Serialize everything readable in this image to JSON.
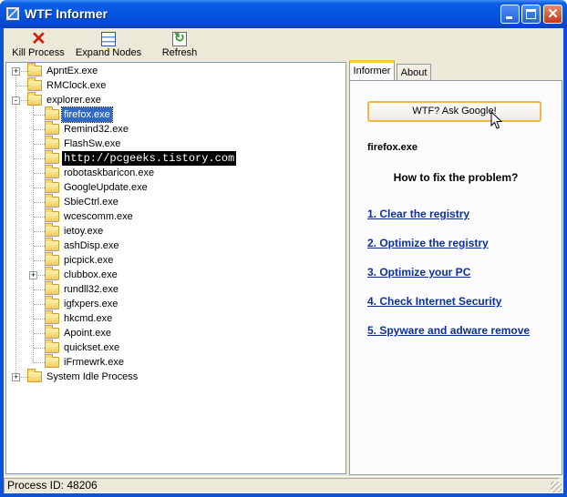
{
  "window": {
    "title": "WTF Informer"
  },
  "toolbar": {
    "kill_label": "Kill Process",
    "expand_label": "Expand Nodes",
    "refresh_label": "Refresh"
  },
  "tree": {
    "nodes": [
      {
        "label": "ApntEx.exe",
        "level": 0,
        "expander": "+"
      },
      {
        "label": "RMClock.exe",
        "level": 0,
        "expander": ""
      },
      {
        "label": "explorer.exe",
        "level": 0,
        "expander": "-"
      },
      {
        "label": "firefox.exe",
        "level": 1,
        "expander": "",
        "selected": true
      },
      {
        "label": "Remind32.exe",
        "level": 1,
        "expander": ""
      },
      {
        "label": "FlashSw.exe",
        "level": 1,
        "expander": ""
      },
      {
        "label": "http://pcgeeks.tistory.com",
        "level": 1,
        "expander": "",
        "dark": true
      },
      {
        "label": "robotaskbaricon.exe",
        "level": 1,
        "expander": ""
      },
      {
        "label": "GoogleUpdate.exe",
        "level": 1,
        "expander": ""
      },
      {
        "label": "SbieCtrl.exe",
        "level": 1,
        "expander": ""
      },
      {
        "label": "wcescomm.exe",
        "level": 1,
        "expander": ""
      },
      {
        "label": "ietoy.exe",
        "level": 1,
        "expander": ""
      },
      {
        "label": "ashDisp.exe",
        "level": 1,
        "expander": ""
      },
      {
        "label": "picpick.exe",
        "level": 1,
        "expander": ""
      },
      {
        "label": "clubbox.exe",
        "level": 1,
        "expander": "+"
      },
      {
        "label": "rundll32.exe",
        "level": 1,
        "expander": ""
      },
      {
        "label": "igfxpers.exe",
        "level": 1,
        "expander": ""
      },
      {
        "label": "hkcmd.exe",
        "level": 1,
        "expander": ""
      },
      {
        "label": "Apoint.exe",
        "level": 1,
        "expander": ""
      },
      {
        "label": "quickset.exe",
        "level": 1,
        "expander": ""
      },
      {
        "label": "iFrmewrk.exe",
        "level": 1,
        "expander": ""
      },
      {
        "label": "System Idle Process",
        "level": 0,
        "expander": "+"
      }
    ]
  },
  "tabs": {
    "informer": "Informer",
    "about": "About"
  },
  "informer": {
    "button_label": "WTF? Ask Google!",
    "process_name": "firefox.exe",
    "heading": "How to fix the problem?",
    "links": [
      "1. Clear the registry",
      "2. Optimize the registry",
      "3. Optimize your PC",
      "4. Check Internet Security",
      "5. Spyware and adware remove"
    ]
  },
  "status": {
    "text": "Process ID: 48206"
  },
  "icons": {
    "app": "app-icon",
    "kill": "red-x-icon",
    "expand": "tree-list-icon",
    "refresh": "refresh-icon",
    "folder": "folder-icon",
    "cursor": "mouse-pointer-icon"
  },
  "colors": {
    "titlebar": "#0555e0",
    "selection": "#316ac5",
    "link": "#0b2fa0",
    "tab_highlight": "#ffc83c"
  }
}
